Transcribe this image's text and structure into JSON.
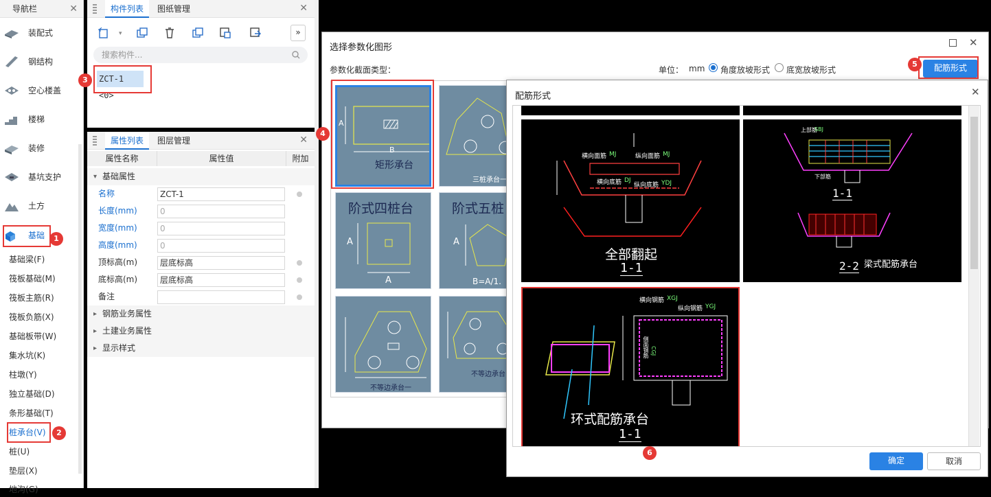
{
  "nav": {
    "title": "导航栏",
    "items": [
      {
        "label": "装配式"
      },
      {
        "label": "钢结构"
      },
      {
        "label": "空心楼盖"
      },
      {
        "label": "楼梯"
      },
      {
        "label": "装修"
      },
      {
        "label": "基坑支护"
      },
      {
        "label": "土方"
      },
      {
        "label": "基础"
      }
    ],
    "subitems": [
      {
        "label": "基础梁(F)"
      },
      {
        "label": "筏板基础(M)"
      },
      {
        "label": "筏板主筋(R)"
      },
      {
        "label": "筏板负筋(X)"
      },
      {
        "label": "基础板带(W)"
      },
      {
        "label": "集水坑(K)"
      },
      {
        "label": "柱墩(Y)"
      },
      {
        "label": "独立基础(D)"
      },
      {
        "label": "条形基础(T)"
      },
      {
        "label": "桩承台(V)"
      },
      {
        "label": "桩(U)"
      },
      {
        "label": "垫层(X)"
      },
      {
        "label": "地沟(G)"
      }
    ]
  },
  "badges": [
    "1",
    "2",
    "3",
    "4",
    "5",
    "6"
  ],
  "comp": {
    "tabs": [
      "构件列表",
      "图纸管理"
    ],
    "search_placeholder": "搜索构件...",
    "selected": "ZCT-1 <0>",
    "more": "»"
  },
  "prop": {
    "tabs": [
      "属性列表",
      "图层管理"
    ],
    "headers": [
      "属性名称",
      "属性值",
      "附加"
    ],
    "group_base": "基础属性",
    "rows": [
      {
        "name": "名称",
        "value": "ZCT-1"
      },
      {
        "name": "长度(mm)",
        "value": "0"
      },
      {
        "name": "宽度(mm)",
        "value": "0"
      },
      {
        "name": "高度(mm)",
        "value": "0"
      },
      {
        "name": "顶标高(m)",
        "value": "层底标高"
      },
      {
        "name": "底标高(m)",
        "value": "层底标高"
      },
      {
        "name": "备注",
        "value": ""
      }
    ],
    "groups": [
      "钢筋业务属性",
      "土建业务属性",
      "显示样式"
    ]
  },
  "dlg1": {
    "title": "选择参数化图形",
    "section_label": "参数化截面类型：",
    "unit_label": "单位：",
    "unit": "mm",
    "radio1": "角度放坡形式",
    "radio2": "底宽放坡形式",
    "rebar_button": "配筋形式",
    "shapes": {
      "rect": "矩形承台",
      "rect_a": "A",
      "rect_b": "B",
      "tri": "三桩承台一",
      "step4": "阶式四桩台",
      "step4_a": "A",
      "step4_a2": "A",
      "step5": "阶式五桩",
      "step5_a": "A",
      "step5_b": "B=A/1.",
      "uneq": "不等边承台一",
      "uneq2": "不等边承台"
    }
  },
  "dlg2": {
    "title": "配筋形式",
    "img1": {
      "title": "全部翻起",
      "section": "1-1",
      "t1": "横向面筋",
      "t1c": "MJ",
      "t2": "纵向面筋",
      "t2c": "MJ",
      "t3": "横向底筋",
      "t3c": "DJ",
      "t4": "纵向底筋",
      "t4c": "YDJ"
    },
    "img2": {
      "title": "梁式配筋承台",
      "s1": "1-1",
      "s2": "2-2",
      "t1": "上部筋",
      "t1c": "SBJ",
      "t2": "下部筋"
    },
    "img3": {
      "title": "环式配筋承台",
      "section": "1-1",
      "t1": "横向钢筋",
      "t1c": "XGJ",
      "t2": "纵向钢筋",
      "t2c": "YGJ",
      "t3": "侧面钢筋",
      "t3c": "CGJ"
    },
    "ok": "确定",
    "cancel": "取消"
  }
}
